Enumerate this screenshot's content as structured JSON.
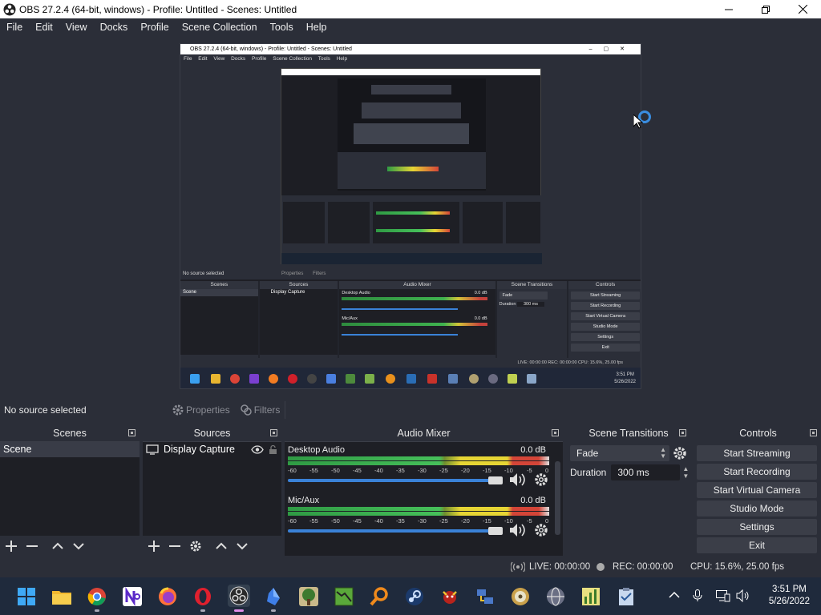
{
  "window": {
    "title": "OBS 27.2.4 (64-bit, windows) - Profile: Untitled - Scenes: Untitled",
    "controls": [
      "minimize-icon",
      "maximize-icon",
      "close-icon"
    ]
  },
  "menu": [
    "File",
    "Edit",
    "View",
    "Docks",
    "Profile",
    "Scene Collection",
    "Tools",
    "Help"
  ],
  "preview": {
    "nested": {
      "title": "OBS 27.2.4 (64-bit, windows) - Profile: Untitled - Scenes: Untitled",
      "menu": [
        "File",
        "Edit",
        "View",
        "Docks",
        "Profile",
        "Scene Collection",
        "Tools",
        "Help"
      ],
      "no_source": "No source selected",
      "properties": "Properties",
      "filters": "Filters",
      "scenes_title": "Scenes",
      "sources_title": "Sources",
      "mixer_title": "Audio Mixer",
      "transitions_title": "Scene Transitions",
      "controls_title": "Controls",
      "scene_item": "Scene",
      "source_item": "Display Capture",
      "ch1_name": "Desktop Audio",
      "ch1_db": "0.0 dB",
      "ch2_name": "Mic/Aux",
      "ch2_db": "0.0 dB",
      "transition": "Fade",
      "duration_label": "Duration",
      "duration": "300 ms",
      "buttons": [
        "Start Streaming",
        "Start Recording",
        "Start Virtual Camera",
        "Studio Mode",
        "Settings",
        "Exit"
      ],
      "status": "LIVE: 00:00:00   REC: 00:00:00   CPU: 15.6%, 25.00 fps",
      "time": "3:51 PM",
      "date": "5/26/2022"
    }
  },
  "source_toolbar": {
    "no_source": "No source selected",
    "properties": "Properties",
    "filters": "Filters"
  },
  "scenes": {
    "title": "Scenes",
    "items": [
      "Scene"
    ],
    "footer_icons": [
      "add-icon",
      "remove-icon",
      "move-up-icon",
      "move-down-icon"
    ]
  },
  "sources": {
    "title": "Sources",
    "items": [
      {
        "name": "Display Capture",
        "visible": true,
        "locked": false
      }
    ],
    "footer_icons": [
      "add-icon",
      "remove-icon",
      "gear-icon",
      "move-up-icon",
      "move-down-icon"
    ]
  },
  "mixer": {
    "title": "Audio Mixer",
    "scale": [
      "-60",
      "-55",
      "-50",
      "-45",
      "-40",
      "-35",
      "-30",
      "-25",
      "-20",
      "-15",
      "-10",
      "-5",
      "0"
    ],
    "channels": [
      {
        "name": "Desktop Audio",
        "db": "0.0 dB",
        "volume": 1.0
      },
      {
        "name": "Mic/Aux",
        "db": "0.0 dB",
        "volume": 1.0
      }
    ]
  },
  "transitions": {
    "title": "Scene Transitions",
    "selected": "Fade",
    "duration_label": "Duration",
    "duration": "300 ms"
  },
  "controls": {
    "title": "Controls",
    "buttons": [
      "Start Streaming",
      "Start Recording",
      "Start Virtual Camera",
      "Studio Mode",
      "Settings",
      "Exit"
    ]
  },
  "status": {
    "live": "LIVE: 00:00:00",
    "rec": "REC: 00:00:00",
    "cpu": "CPU: 15.6%, 25.00 fps"
  },
  "taskbar": {
    "apps": [
      "windows-start-icon",
      "file-explorer-icon",
      "chrome-icon",
      "notion-like-icon",
      "firefox-icon",
      "opera-icon",
      "obs-icon",
      "crystal-app-icon",
      "tree-app-icon",
      "map-app-icon",
      "search-magnifier-icon",
      "steam-icon",
      "game-app-icon",
      "network-app-icon",
      "disc-app-icon",
      "globe-app-icon",
      "chart-app-icon",
      "clipboard-app-icon"
    ],
    "time": "3:51 PM",
    "date": "5/26/2022"
  },
  "colors": {
    "background": "#2b2e38",
    "panel": "#1e1f25",
    "button": "#3b3e48",
    "accent": "#3a82d8"
  }
}
